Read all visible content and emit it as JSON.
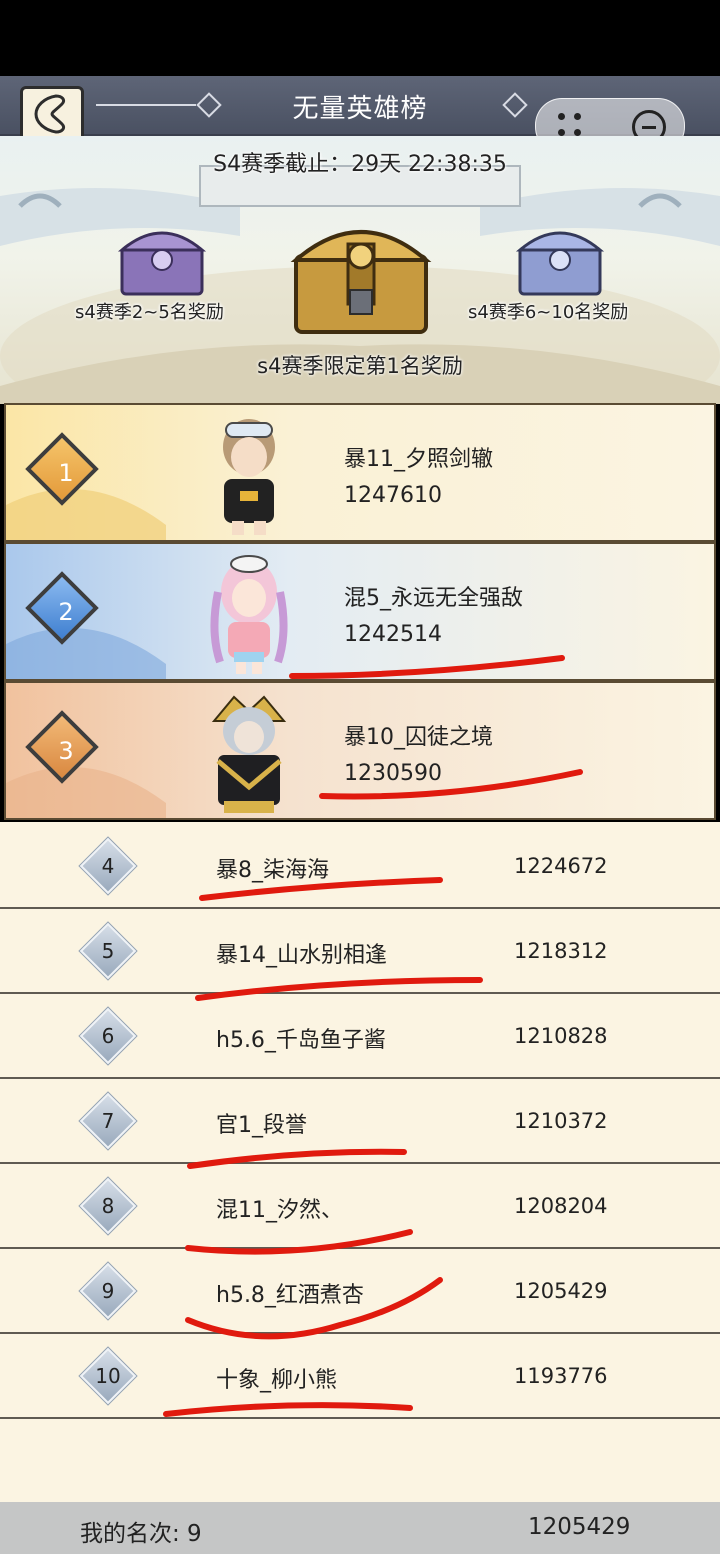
{
  "header": {
    "title": "无量英雄榜"
  },
  "banner": {
    "season_countdown": "S4赛季截止：29天 22:38:35",
    "left_chest_label": "s4赛季2~5名奖励",
    "right_chest_label": "s4赛季6~10名奖励",
    "center_chest_label": "s4赛季限定第1名奖励"
  },
  "top_ranks": [
    {
      "rank": "1",
      "name": "暴11_夕照剑辙",
      "score": "1247610"
    },
    {
      "rank": "2",
      "name": "混5_永远无全强敌",
      "score": "1242514"
    },
    {
      "rank": "3",
      "name": "暴10_囚徒之境",
      "score": "1230590"
    }
  ],
  "ranks": [
    {
      "rank": "4",
      "name": "暴8_柒海海",
      "score": "1224672"
    },
    {
      "rank": "5",
      "name": "暴14_山水别相逢",
      "score": "1218312"
    },
    {
      "rank": "6",
      "name": "h5.6_千岛鱼子酱",
      "score": "1210828"
    },
    {
      "rank": "7",
      "name": "官1_段誉",
      "score": "1210372"
    },
    {
      "rank": "8",
      "name": "混11_汐然、",
      "score": "1208204"
    },
    {
      "rank": "9",
      "name": "h5.8_红酒煮杏",
      "score": "1205429"
    },
    {
      "rank": "10",
      "name": "十象_柳小熊",
      "score": "1193776"
    }
  ],
  "footer": {
    "my_rank_label": "我的名次: 9",
    "my_score": "1205429"
  },
  "colors": {
    "annotation": "#e01a0e",
    "gold": "#e7a94a",
    "blue": "#4f8fd8",
    "bronze": "#e19a55",
    "list_bg": "#fbf4e2"
  }
}
